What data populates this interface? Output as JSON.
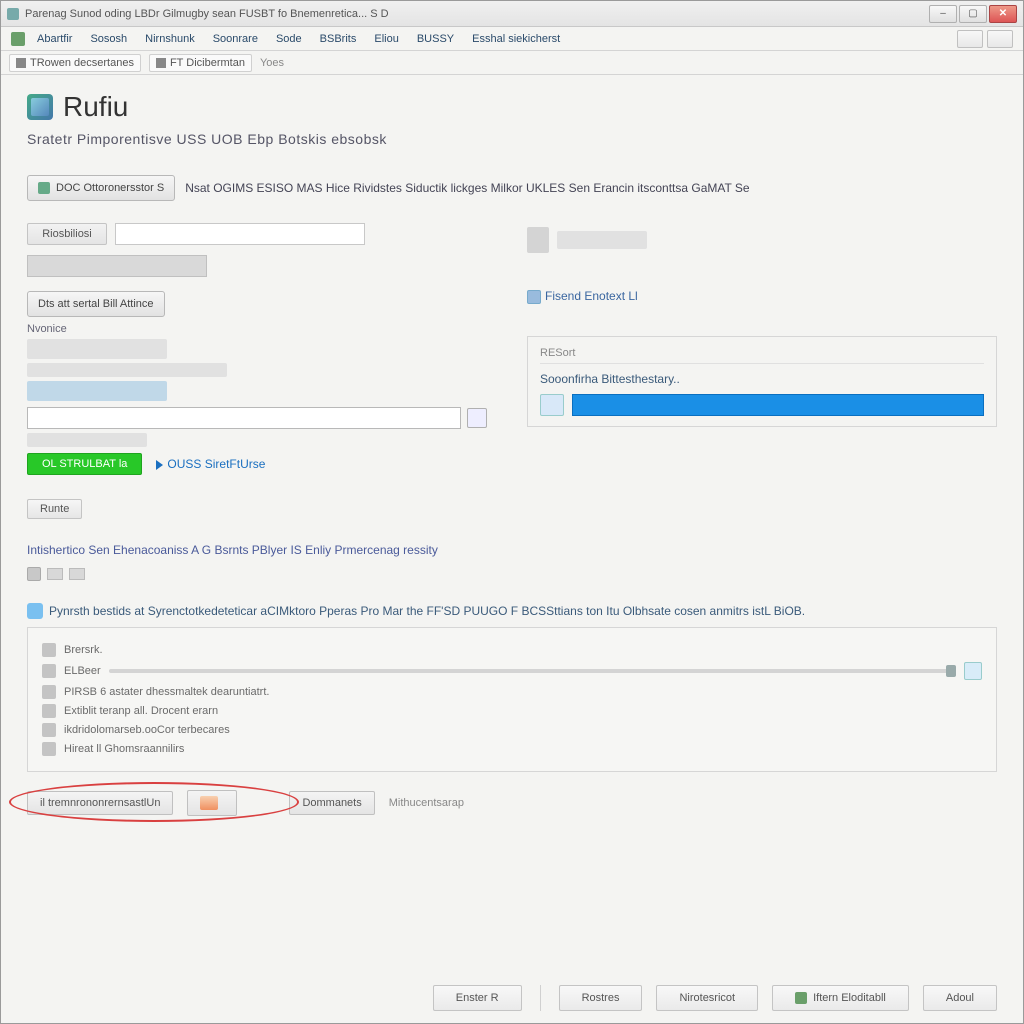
{
  "titlebar": "Parenag Sunod oding LBDr Gilmugby sean FUSBT fo Bnemenretica... S  D",
  "menubar": [
    "Abartfir",
    "Sososh",
    "Nirnshunk",
    "Soonrare",
    "Sode",
    "BSBrits",
    "Eliou",
    "BUSSY",
    "Esshal siekicherst"
  ],
  "toolbar2": {
    "a": "TRowen decsertanes",
    "b": "FT Dicibermtan",
    "c": "Yoes"
  },
  "app": {
    "title": "Rufiu",
    "subtitle": "Sratetr Pimporentisve USS UOB Ebp Botskis ebsobsk"
  },
  "btn_select": "DOC Ottoronersstor S",
  "desc_select": "Nsat OGIMS ESISO MAS Hice Rividstes Siductik lickges Milkor UKLES Sen Erancin itsconttsa GaMAT Se",
  "field1_label": "Riosbiliosi",
  "linkbox": "Fisend Enotext Ll",
  "btn_disk": "Dts att sertal Bill Attince",
  "name_label": "Nvonice",
  "panel_head": "RESort",
  "progress_label": "Sooonfirha Bittesthestary..",
  "green_btn": "OL STRULBAT la",
  "blue_link": "OUSS SiretFtUrse",
  "mini_btn": "Runte",
  "instruction": "Intishertico Sen Ehenacoaniss A G Bsrnts PBlyer IS Enliy Prmercenag ressity",
  "info_label": "Pynrsth bestids at Syrenctotkedeteticar aCIMktoro Pperas Pro Mar the FF'SD PUUGO F BCSSttians ton Itu Olbhsate cosen anmitrs istL BiOB.",
  "opts": [
    "Brersrk.",
    "ELBeer",
    "PIRSB 6 astater dhessmaltek dearuntiatrt.",
    "Extiblit teranp all. Drocent erarn",
    "ikdridolomarseb.ooCor terbecares",
    "Hireat ll Ghomsraannilirs"
  ],
  "bottom": {
    "a": "il tremnrononrernsastlUn",
    "b": "",
    "c": "Dommanets",
    "d": "Mithucentsarap"
  },
  "footer": [
    "Enster R",
    "Rostres",
    "Nirotesricot",
    "Iftern Eloditabll",
    "Adoul"
  ]
}
